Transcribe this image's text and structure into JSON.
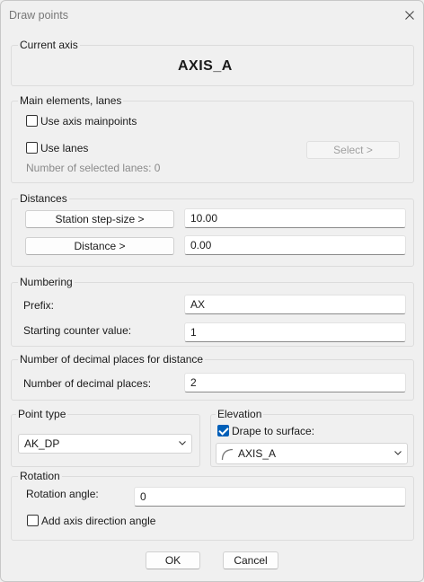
{
  "window": {
    "title": "Draw points"
  },
  "current_axis": {
    "label": "Current axis",
    "value": "AXIS_A"
  },
  "main_elements": {
    "label": "Main elements, lanes",
    "use_axis_mainpoints": {
      "label": "Use axis mainpoints",
      "checked": false
    },
    "use_lanes": {
      "label": "Use lanes",
      "checked": false
    },
    "select_button": "Select >",
    "selected_lanes_text": "Number of selected lanes: 0"
  },
  "distances": {
    "label": "Distances",
    "station_step_button": "Station step-size >",
    "station_step_value": "10.00",
    "distance_button": "Distance >",
    "distance_value": "0.00"
  },
  "numbering": {
    "label": "Numbering",
    "prefix_label": "Prefix:",
    "prefix_value": "AX",
    "start_label": "Starting counter value:",
    "start_value": "1"
  },
  "decimals": {
    "label": "Number of decimal places for distance",
    "places_label": "Number of decimal places:",
    "places_value": "2"
  },
  "point_type": {
    "label": "Point type",
    "selected": "AK_DP"
  },
  "elevation": {
    "label": "Elevation",
    "drape_label": "Drape to surface:",
    "drape_checked": true,
    "surface_selected": "AXIS_A"
  },
  "rotation": {
    "label": "Rotation",
    "angle_label": "Rotation angle:",
    "angle_value": "0",
    "add_direction_label": "Add axis direction angle",
    "add_direction_checked": false
  },
  "footer": {
    "ok": "OK",
    "cancel": "Cancel"
  },
  "icons": {
    "close": "close-icon",
    "chevron": "chevron-down-icon",
    "surface": "surface-arc-icon",
    "check": "checkmark-icon"
  },
  "colors": {
    "accent": "#005fb8",
    "background": "#f0f0f0",
    "disabled_text": "#a0a0a0"
  }
}
